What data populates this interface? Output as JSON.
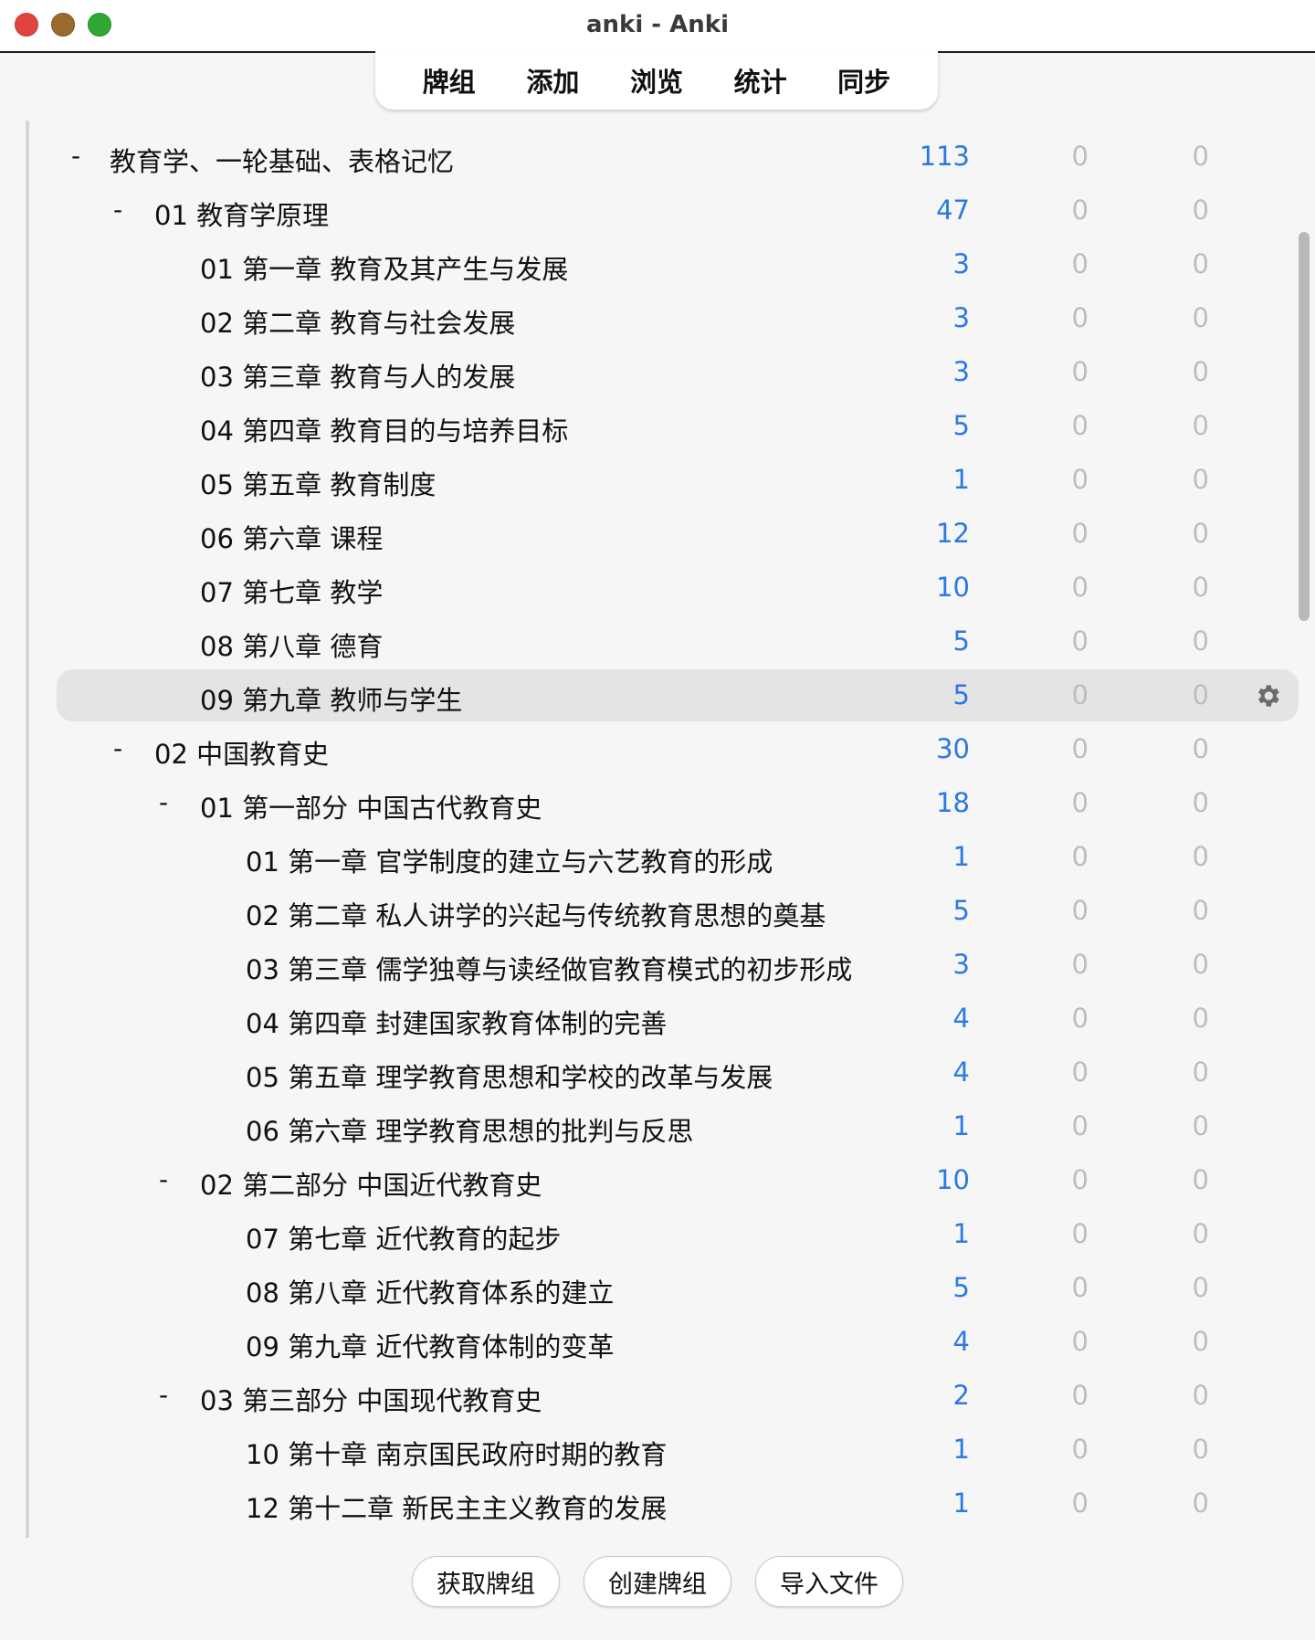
{
  "window": {
    "title": "anki - Anki"
  },
  "toolbar": {
    "items": [
      "牌组",
      "添加",
      "浏览",
      "统计",
      "同步"
    ]
  },
  "decks": [
    {
      "name": "教育学、一轮基础、表格记忆",
      "collapse": "-",
      "level": 0,
      "new": "113",
      "learn": "0",
      "due": "0"
    },
    {
      "name": "01 教育学原理",
      "collapse": "-",
      "level": 1,
      "new": "47",
      "learn": "0",
      "due": "0"
    },
    {
      "name": "01 第一章 教育及其产生与发展",
      "collapse": "",
      "level": 2,
      "new": "3",
      "learn": "0",
      "due": "0"
    },
    {
      "name": "02 第二章 教育与社会发展",
      "collapse": "",
      "level": 2,
      "new": "3",
      "learn": "0",
      "due": "0"
    },
    {
      "name": "03 第三章 教育与人的发展",
      "collapse": "",
      "level": 2,
      "new": "3",
      "learn": "0",
      "due": "0"
    },
    {
      "name": "04 第四章 教育目的与培养目标",
      "collapse": "",
      "level": 2,
      "new": "5",
      "learn": "0",
      "due": "0"
    },
    {
      "name": "05 第五章 教育制度",
      "collapse": "",
      "level": 2,
      "new": "1",
      "learn": "0",
      "due": "0"
    },
    {
      "name": "06 第六章 课程",
      "collapse": "",
      "level": 2,
      "new": "12",
      "learn": "0",
      "due": "0"
    },
    {
      "name": "07 第七章 教学",
      "collapse": "",
      "level": 2,
      "new": "10",
      "learn": "0",
      "due": "0"
    },
    {
      "name": "08 第八章 德育",
      "collapse": "",
      "level": 2,
      "new": "5",
      "learn": "0",
      "due": "0"
    },
    {
      "name": "09 第九章 教师与学生",
      "collapse": "",
      "level": 2,
      "new": "5",
      "learn": "0",
      "due": "0",
      "current": true
    },
    {
      "name": "02 中国教育史",
      "collapse": "-",
      "level": 1,
      "new": "30",
      "learn": "0",
      "due": "0"
    },
    {
      "name": "01 第一部分 中国古代教育史",
      "collapse": "-",
      "level": 2,
      "new": "18",
      "learn": "0",
      "due": "0"
    },
    {
      "name": "01 第一章 官学制度的建立与六艺教育的形成",
      "collapse": "",
      "level": 3,
      "new": "1",
      "learn": "0",
      "due": "0"
    },
    {
      "name": "02 第二章 私人讲学的兴起与传统教育思想的奠基",
      "collapse": "",
      "level": 3,
      "new": "5",
      "learn": "0",
      "due": "0"
    },
    {
      "name": "03 第三章 儒学独尊与读经做官教育模式的初步形成",
      "collapse": "",
      "level": 3,
      "new": "3",
      "learn": "0",
      "due": "0"
    },
    {
      "name": "04 第四章 封建国家教育体制的完善",
      "collapse": "",
      "level": 3,
      "new": "4",
      "learn": "0",
      "due": "0"
    },
    {
      "name": "05 第五章 理学教育思想和学校的改革与发展",
      "collapse": "",
      "level": 3,
      "new": "4",
      "learn": "0",
      "due": "0"
    },
    {
      "name": "06 第六章 理学教育思想的批判与反思",
      "collapse": "",
      "level": 3,
      "new": "1",
      "learn": "0",
      "due": "0"
    },
    {
      "name": "02 第二部分 中国近代教育史",
      "collapse": "-",
      "level": 2,
      "new": "10",
      "learn": "0",
      "due": "0"
    },
    {
      "name": "07 第七章 近代教育的起步",
      "collapse": "",
      "level": 3,
      "new": "1",
      "learn": "0",
      "due": "0"
    },
    {
      "name": "08 第八章 近代教育体系的建立",
      "collapse": "",
      "level": 3,
      "new": "5",
      "learn": "0",
      "due": "0"
    },
    {
      "name": "09 第九章 近代教育体制的变革",
      "collapse": "",
      "level": 3,
      "new": "4",
      "learn": "0",
      "due": "0"
    },
    {
      "name": "03 第三部分 中国现代教育史",
      "collapse": "-",
      "level": 2,
      "new": "2",
      "learn": "0",
      "due": "0"
    },
    {
      "name": "10 第十章 南京国民政府时期的教育",
      "collapse": "",
      "level": 3,
      "new": "1",
      "learn": "0",
      "due": "0"
    },
    {
      "name": "12 第十二章 新民主主义教育的发展",
      "collapse": "",
      "level": 3,
      "new": "1",
      "learn": "0",
      "due": "0"
    }
  ],
  "bottom": {
    "get_shared": "获取牌组",
    "create_deck": "创建牌组",
    "import_file": "导入文件"
  },
  "colors": {
    "new_count": "#2a7ae2",
    "zero_count": "#bdbdbd",
    "current_row": "#e4e4e4"
  }
}
